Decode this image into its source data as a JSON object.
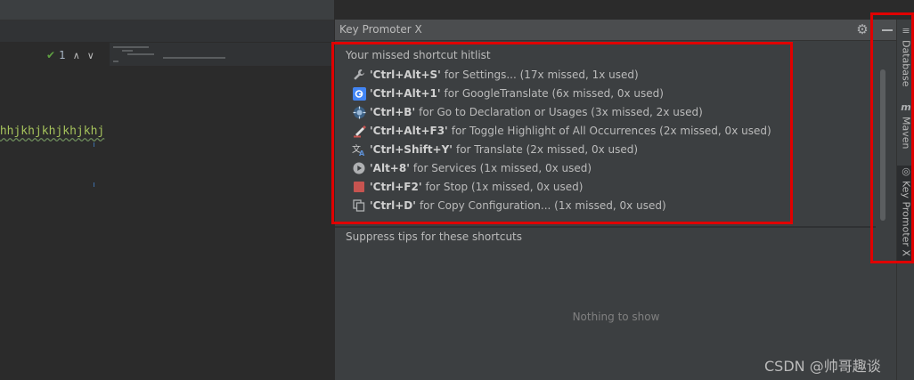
{
  "editor": {
    "problems_count": "1",
    "code_text": "khhjkhjkhjkhjkhj"
  },
  "panel": {
    "title": "Key Promoter X",
    "hitlist_heading": "Your missed shortcut hitlist",
    "items": [
      {
        "shortcut": "'Ctrl+Alt+S'",
        "desc": "for Settings... (17x missed, 1x used)",
        "icon": "wrench-icon"
      },
      {
        "shortcut": "'Ctrl+Alt+1'",
        "desc": "for GoogleTranslate (6x missed, 0x used)",
        "icon": "google-translate-icon"
      },
      {
        "shortcut": "'Ctrl+B'",
        "desc": "for Go to Declaration or Usages (3x missed, 2x used)",
        "icon": "declaration-icon"
      },
      {
        "shortcut": "'Ctrl+Alt+F3'",
        "desc": "for Toggle Highlight of All Occurrences (2x missed, 0x used)",
        "icon": "highlight-pen-icon"
      },
      {
        "shortcut": "'Ctrl+Shift+Y'",
        "desc": "for Translate (2x missed, 0x used)",
        "icon": "translate-icon"
      },
      {
        "shortcut": "'Alt+8'",
        "desc": "for Services (1x missed, 0x used)",
        "icon": "services-icon"
      },
      {
        "shortcut": "'Ctrl+F2'",
        "desc": "for Stop (1x missed, 0x used)",
        "icon": "stop-icon"
      },
      {
        "shortcut": "'Ctrl+D'",
        "desc": "for Copy Configuration... (1x missed, 0x used)",
        "icon": "copy-icon"
      }
    ],
    "suppress_heading": "Suppress tips for these shortcuts",
    "empty_text": "Nothing to show"
  },
  "tool_strip": {
    "database": "Database",
    "maven": "Maven",
    "key_promoter": "Key Promoter X"
  },
  "watermark": "CSDN @帅哥趣谈",
  "colors": {
    "highlight": "#e00000",
    "stop": "#c75450",
    "google_blue": "#4285f4"
  }
}
